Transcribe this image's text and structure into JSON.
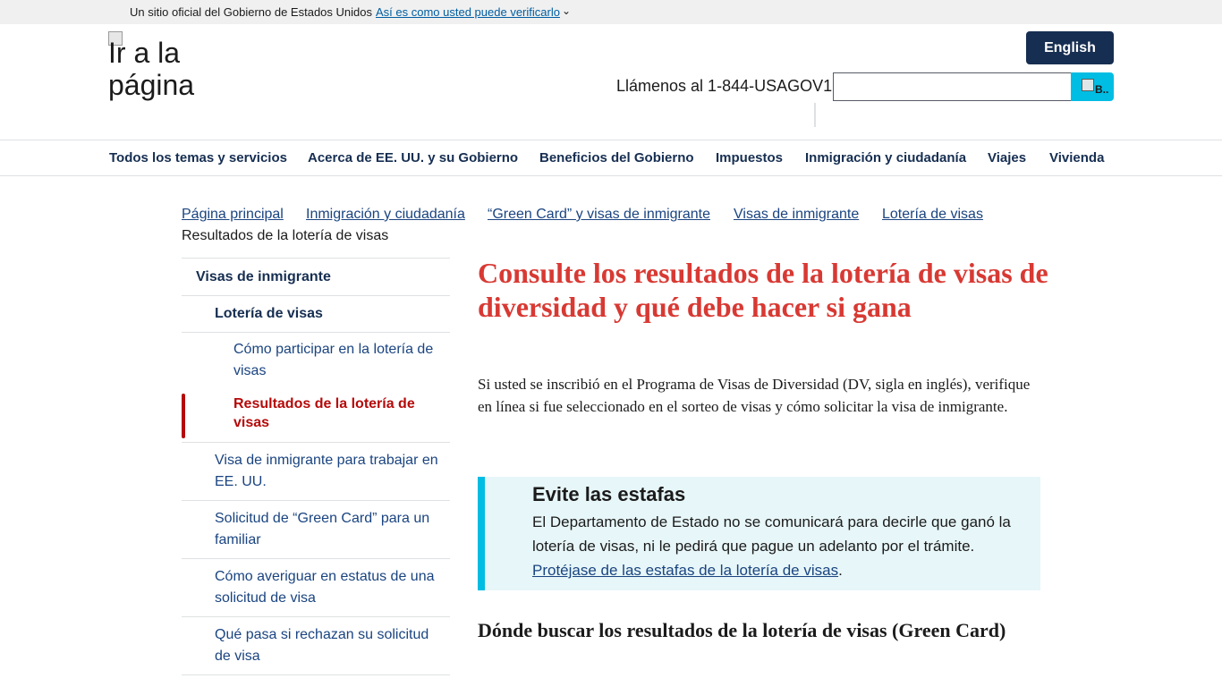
{
  "gov_banner": {
    "official_text": "Un sitio oficial del Gobierno de Estados Unidos",
    "verify_link": "Así es como usted puede verificarlo",
    "verify_chevron": "⌄"
  },
  "header": {
    "logo_alt": "Ir a la página",
    "language_button": "English",
    "call_text": "Llámenos al 1-844-USAGOV1",
    "search_placeholder": "",
    "search_button_alt": "B.."
  },
  "main_nav": {
    "items": [
      {
        "label": "Todos los temas y servicios"
      },
      {
        "label": "Acerca de EE. UU. y su Gobierno"
      },
      {
        "label": "Beneficios del Gobierno"
      },
      {
        "label": "Impuestos"
      },
      {
        "label": "Inmigración y ciudadanía"
      },
      {
        "label": "Viajes"
      },
      {
        "label": "Vivienda"
      }
    ]
  },
  "breadcrumb": {
    "items": [
      {
        "label": "Página principal"
      },
      {
        "label": "Inmigración y ciudadanía"
      },
      {
        "label": "“Green Card” y visas de inmigrante"
      },
      {
        "label": "Visas de inmigrante"
      },
      {
        "label": "Lotería de visas"
      }
    ],
    "current": "Resultados de la lotería de visas"
  },
  "sidenav": {
    "items": [
      {
        "label": "Visas de inmigrante"
      },
      {
        "label": "Lotería de visas"
      },
      {
        "label": "Cómo participar en la lotería de visas"
      },
      {
        "label": "Resultados de la lotería de visas"
      },
      {
        "label": "Visa de inmigrante para trabajar en EE. UU."
      },
      {
        "label": "Solicitud de “Green Card” para un familiar"
      },
      {
        "label": "Cómo averiguar en estatus de una solicitud de visa"
      },
      {
        "label": "Qué pasa si rechazan su solicitud de visa"
      }
    ]
  },
  "content": {
    "title": "Consulte los resultados de la lotería de visas de diversidad y qué debe hacer si gana",
    "intro": "Si usted se inscribió en el Programa de Visas de Diversidad (DV, sigla en inglés), verifique en línea si fue seleccionado en el sorteo de visas y cómo solicitar la visa de inmigrante.",
    "alert": {
      "heading": "Evite las estafas",
      "body": "El Departamento de Estado no se comunicará para decirle que ganó la lotería de visas, ni le pedirá que pague un adelanto por el trámite.",
      "link": "Protéjase de las estafas de la lotería de visas",
      "after_link": "."
    },
    "section_title": "Dónde buscar los resultados de la lotería de visas (Green Card)"
  },
  "colors": {
    "title_red": "#d83933",
    "nav_navy": "#162e51",
    "link_blue": "#1a4480",
    "accent_cyan": "#00bde3",
    "current_red": "#b50909",
    "alert_bg": "#e7f6f8"
  }
}
